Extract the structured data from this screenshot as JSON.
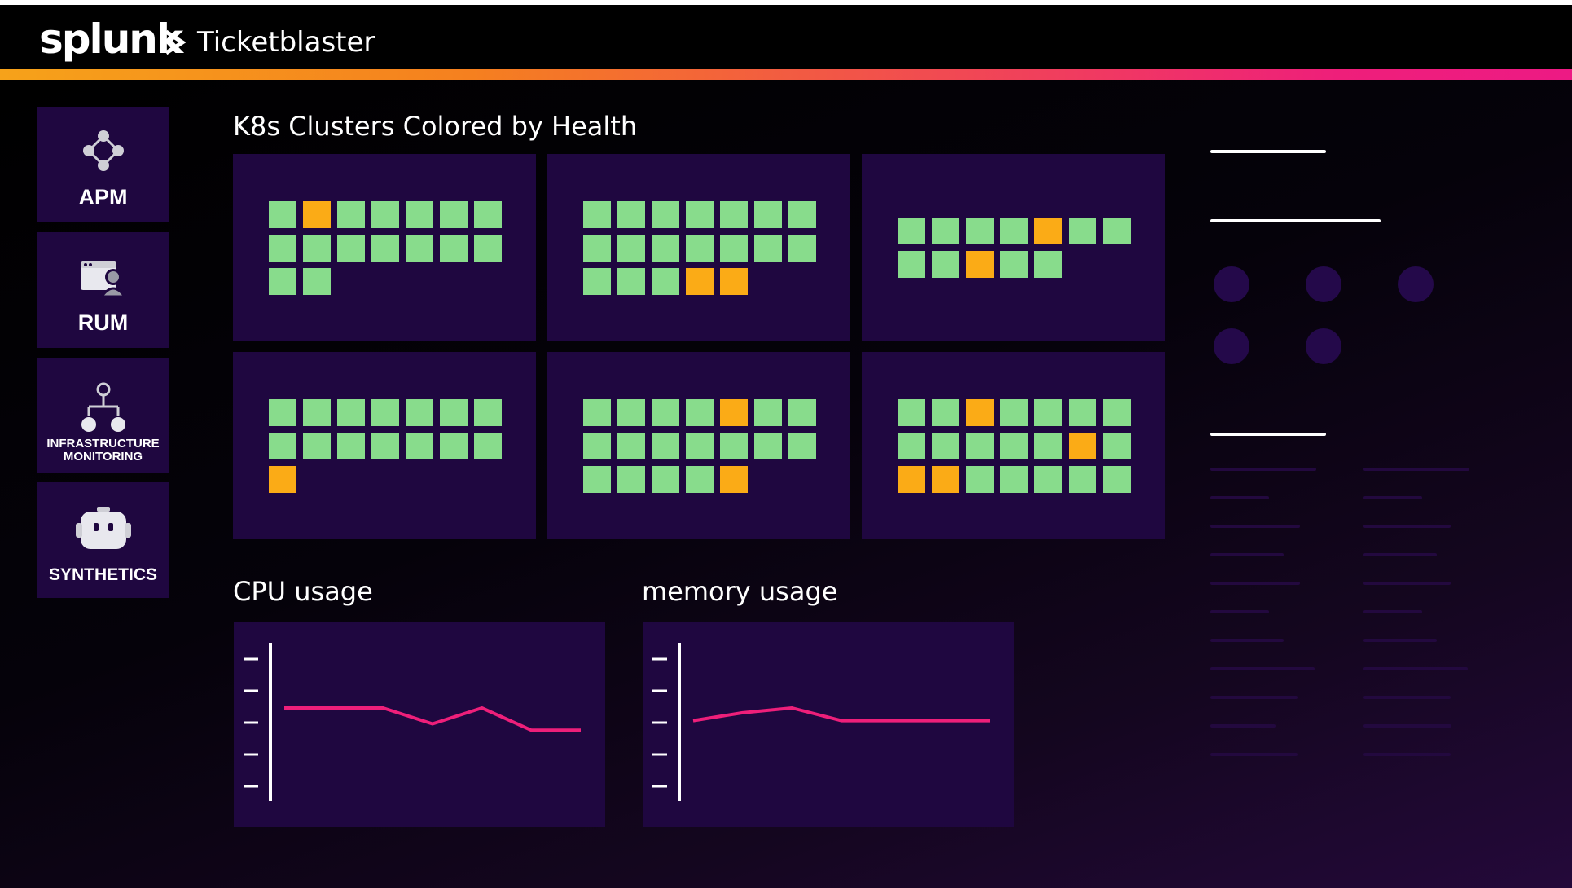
{
  "header": {
    "logo_text": "splunk",
    "app_title": "Ticketblaster",
    "accent_gradient": [
      "#f6a21a",
      "#ed1a84"
    ]
  },
  "nav": {
    "items": [
      {
        "label": "APM",
        "icon": "service-map-icon"
      },
      {
        "label": "RUM",
        "icon": "browser-user-icon"
      },
      {
        "label": "INFRASTRUCTURE\nMONITORING",
        "icon": "hierarchy-icon"
      },
      {
        "label": "SYNTHETICS",
        "icon": "robot-icon"
      }
    ]
  },
  "clusters": {
    "title": "K8s Clusters Colored by Health",
    "healthy_color": "#88dc8c",
    "warning_color": "#fbab16",
    "panels": [
      {
        "rows": [
          [
            "h",
            "w",
            "h",
            "h",
            "h",
            "h",
            "h"
          ],
          [
            "h",
            "h",
            "h",
            "h",
            "h",
            "h",
            "h"
          ],
          [
            "h",
            "h"
          ]
        ]
      },
      {
        "rows": [
          [
            "h",
            "h",
            "h",
            "h",
            "h",
            "h",
            "h"
          ],
          [
            "h",
            "h",
            "h",
            "h",
            "h",
            "h",
            "h"
          ],
          [
            "h",
            "h",
            "h",
            "w",
            "w"
          ]
        ]
      },
      {
        "rows": [
          [
            "h",
            "h",
            "h",
            "h",
            "w",
            "h",
            "h"
          ],
          [
            "h",
            "h",
            "w",
            "h",
            "h"
          ]
        ]
      },
      {
        "rows": [
          [
            "h",
            "h",
            "h",
            "h",
            "h",
            "h",
            "h"
          ],
          [
            "h",
            "h",
            "h",
            "h",
            "h",
            "h",
            "h"
          ],
          [
            "w"
          ]
        ]
      },
      {
        "rows": [
          [
            "h",
            "h",
            "h",
            "h",
            "w",
            "h",
            "h"
          ],
          [
            "h",
            "h",
            "h",
            "h",
            "h",
            "h",
            "h"
          ],
          [
            "h",
            "h",
            "h",
            "h",
            "w"
          ]
        ]
      },
      {
        "rows": [
          [
            "h",
            "h",
            "w",
            "h",
            "h",
            "h",
            "h"
          ],
          [
            "h",
            "h",
            "h",
            "h",
            "h",
            "w",
            "h"
          ],
          [
            "w",
            "w",
            "h",
            "h",
            "h",
            "h",
            "h"
          ]
        ]
      }
    ]
  },
  "charts": {
    "cpu": {
      "title": "CPU usage",
      "line_color": "#ee1f7a"
    },
    "memory": {
      "title": "memory usage",
      "line_color": "#ee1f7a"
    }
  },
  "chart_data": [
    {
      "type": "line",
      "title": "CPU usage",
      "xlabel": "",
      "ylabel": "",
      "ylim": [
        0,
        5
      ],
      "series": [
        {
          "x": [
            0,
            1,
            2,
            3,
            4,
            5,
            6
          ],
          "values": [
            3.0,
            3.0,
            3.0,
            2.5,
            3.0,
            2.3,
            2.3
          ]
        }
      ]
    },
    {
      "type": "line",
      "title": "memory usage",
      "xlabel": "",
      "ylabel": "",
      "ylim": [
        0,
        5
      ],
      "series": [
        {
          "x": [
            0,
            1,
            2,
            3,
            4,
            5,
            6
          ],
          "values": [
            2.6,
            2.85,
            3.0,
            2.6,
            2.6,
            2.6,
            2.6
          ]
        }
      ]
    }
  ]
}
